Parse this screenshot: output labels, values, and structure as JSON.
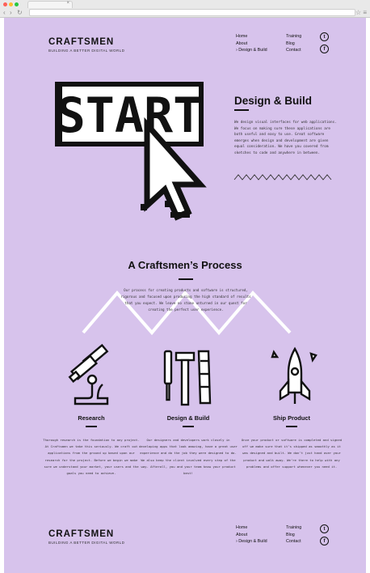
{
  "browser": {
    "traffic_lights": [
      "#ff5f57",
      "#febc2e",
      "#28c840"
    ],
    "tab_close": "×",
    "back": "‹",
    "forward": "›",
    "reload": "↻",
    "menu": "☆  ≡"
  },
  "header": {
    "logo": "CRAFTSMEN",
    "tagline": "BUILDING A BETTER DIGITAL WORLD",
    "nav_col1": [
      "Home",
      "About",
      "› Design & Build"
    ],
    "nav_col2": [
      "Training",
      "Blog",
      "Contact"
    ],
    "social": [
      "twitter-icon",
      "facebook-icon"
    ]
  },
  "hero": {
    "start_word": "START",
    "title": "Design & Build",
    "body": "We design visual interfaces for web applications. We focus on making sure these applications are both useful and easy to use. Great software emerges when design and development are given equal consideration. We have you covered from sketches to code and anywhere in between."
  },
  "process": {
    "title": "A Craftsmen’s Process",
    "body": "Our process for creating products and software is structured, rigorous and focused upon producing the high standard of results that you expect. We leave no stone unturned in our quest for creating the perfect user experience."
  },
  "columns": [
    {
      "icon": "microscope-icon",
      "title": "Research",
      "body": "Thorough research is the foundation to any project. At Craftsmen we take this seriously. We craft out applications from the ground up based upon our research for the project. Before we begin we make sure we understand your market, your users and the goals you need to achieve."
    },
    {
      "icon": "tools-icon",
      "title": "Design & Build",
      "body": "Our designers and developers work closely in developing apps that look amazing, have a great user experience and do the job they were designed to do. We also keep the client involved every step of the way. Afterall, you and your team know your product best!"
    },
    {
      "icon": "rocket-icon",
      "title": "Ship Product",
      "body": "Once your product or software is completed and signed off we make sure that it’s shipped as smoothly as it was designed and built. We don’t just hand over your product and walk away. We’re there to help with any problems and offer support whenever you need it."
    }
  ],
  "footer": {
    "logo": "CRAFTSMEN",
    "tagline": "BUILDING A BETTER DIGITAL WORLD",
    "nav_col1": [
      "Home",
      "About",
      "› Design & Build"
    ],
    "nav_col2": [
      "Training",
      "Blog",
      "Contact"
    ]
  },
  "colors": {
    "page_bg": "#d7c3ec",
    "ink": "#111111"
  }
}
